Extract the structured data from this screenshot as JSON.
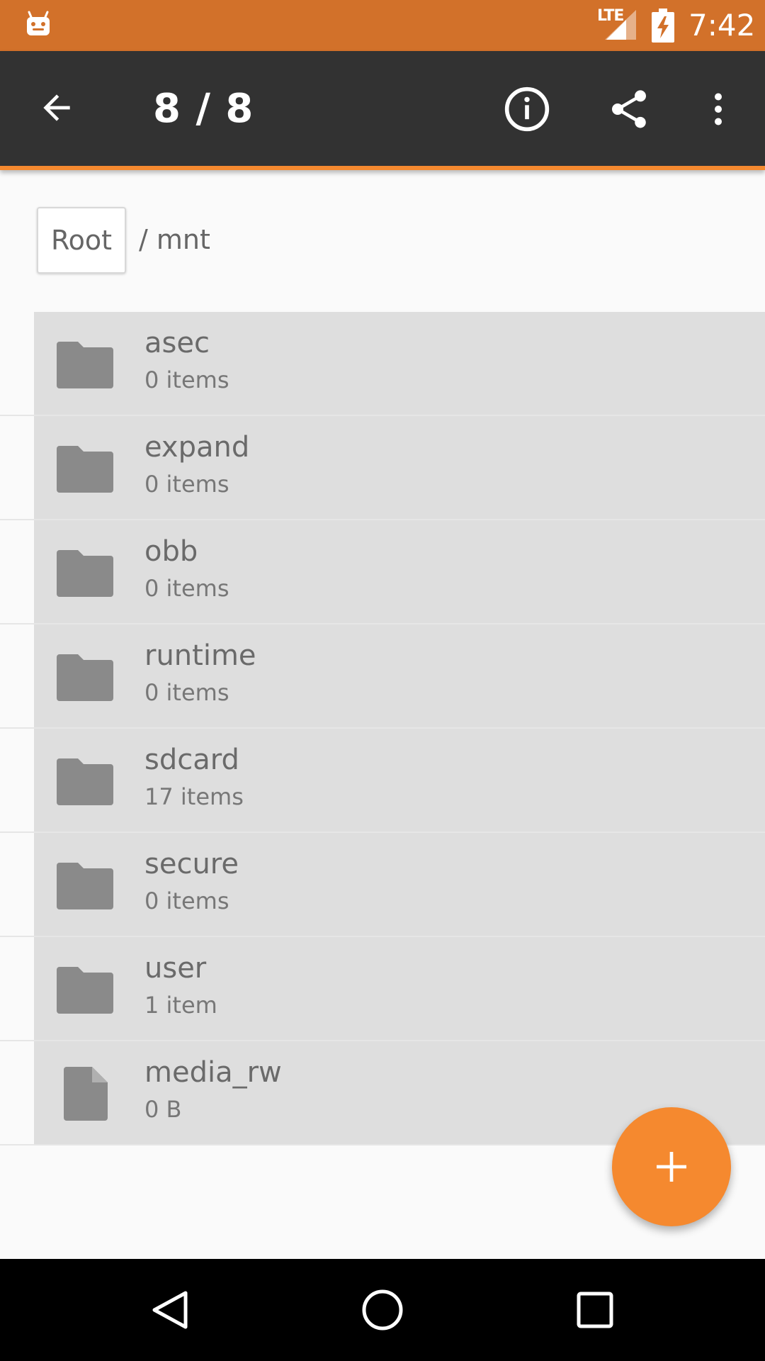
{
  "status_bar": {
    "network": "LTE",
    "clock": "7:42"
  },
  "toolbar": {
    "title": "8 / 8",
    "icons": {
      "back": "arrow-back-icon",
      "info": "info-icon",
      "share": "share-icon",
      "more": "more-vert-icon"
    }
  },
  "breadcrumb": {
    "root_label": "Root",
    "path": "/ mnt"
  },
  "files": [
    {
      "name": "asec",
      "meta": "0 items",
      "type": "folder"
    },
    {
      "name": "expand",
      "meta": "0 items",
      "type": "folder"
    },
    {
      "name": "obb",
      "meta": "0 items",
      "type": "folder"
    },
    {
      "name": "runtime",
      "meta": "0 items",
      "type": "folder"
    },
    {
      "name": "sdcard",
      "meta": "17 items",
      "type": "folder"
    },
    {
      "name": "secure",
      "meta": "0 items",
      "type": "folder"
    },
    {
      "name": "user",
      "meta": "1 item",
      "type": "folder"
    },
    {
      "name": "media_rw",
      "meta": "0 B",
      "type": "file"
    }
  ],
  "colors": {
    "status_bar": "#d2712a",
    "toolbar": "#323232",
    "accent": "#f5892f",
    "row_selected": "#dedede",
    "icon_gray": "#8a8a8a"
  }
}
